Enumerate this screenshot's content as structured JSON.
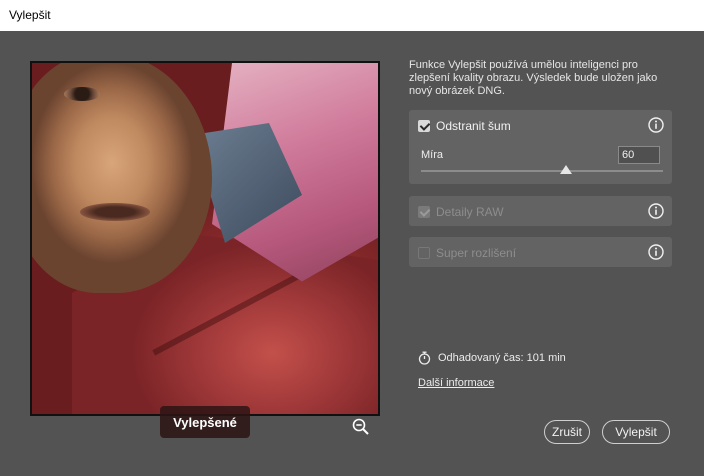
{
  "window": {
    "title": "Vylepšit"
  },
  "preview": {
    "badge": "Vylepšené",
    "zoom_icon": "zoom-out-icon"
  },
  "description": "Funkce Vylepšit používá umělou inteligenci pro zlepšení kvality obrazu. Výsledek bude uložen jako nový obrázek DNG.",
  "options": {
    "denoise": {
      "label": "Odstranit šum",
      "checked": true,
      "amount_label": "Míra",
      "amount": "60",
      "amount_fraction": 0.6
    },
    "raw_details": {
      "label": "Detaily RAW",
      "checked": true,
      "disabled": true
    },
    "super_resolution": {
      "label": "Super rozlišení",
      "checked": false,
      "disabled": true
    }
  },
  "estimate": {
    "label": "Odhadovaný čas: 101 min",
    "icon": "stopwatch-icon"
  },
  "more_info_link": "Další informace",
  "buttons": {
    "cancel": "Zrušit",
    "enhance": "Vylepšit"
  },
  "colors": {
    "background": "#535353",
    "panel": "#636363",
    "titlebar": "#ffffff"
  }
}
